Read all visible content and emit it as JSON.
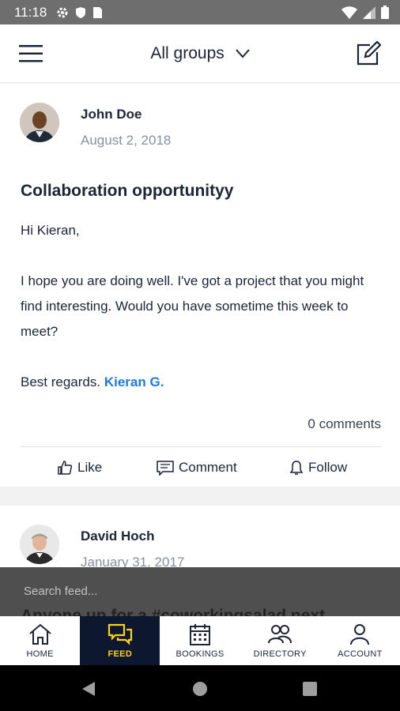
{
  "status_bar": {
    "time": "11:18"
  },
  "app_bar": {
    "title": "All groups"
  },
  "post1": {
    "author": "John Doe",
    "date": "August 2, 2018",
    "title": "Collaboration opportunityy",
    "greeting": "Hi Kieran,",
    "body": "I hope you are doing well. I've got a project that you might find interesting. Would you have sometime this week to meet?",
    "signoff": "Best regards.",
    "mention": "Kieran G.",
    "comments": "0 comments",
    "actions": {
      "like": "Like",
      "comment": "Comment",
      "follow": "Follow"
    }
  },
  "post2": {
    "author": "David Hoch",
    "date": "January 31, 2017",
    "title_peek": "Anyone up for a #coworkingsalad next"
  },
  "search": {
    "placeholder": "Search feed..."
  },
  "bottom_nav": {
    "items": [
      {
        "label": "HOME",
        "icon": "home-icon"
      },
      {
        "label": "FEED",
        "icon": "feed-icon",
        "active": true
      },
      {
        "label": "BOOKINGS",
        "icon": "calendar-icon"
      },
      {
        "label": "DIRECTORY",
        "icon": "people-icon"
      },
      {
        "label": "ACCOUNT",
        "icon": "person-icon"
      }
    ]
  },
  "colors": {
    "nav_active_bg": "#0e1730",
    "nav_active_fg": "#ffd21f",
    "link": "#1f7ae0"
  }
}
